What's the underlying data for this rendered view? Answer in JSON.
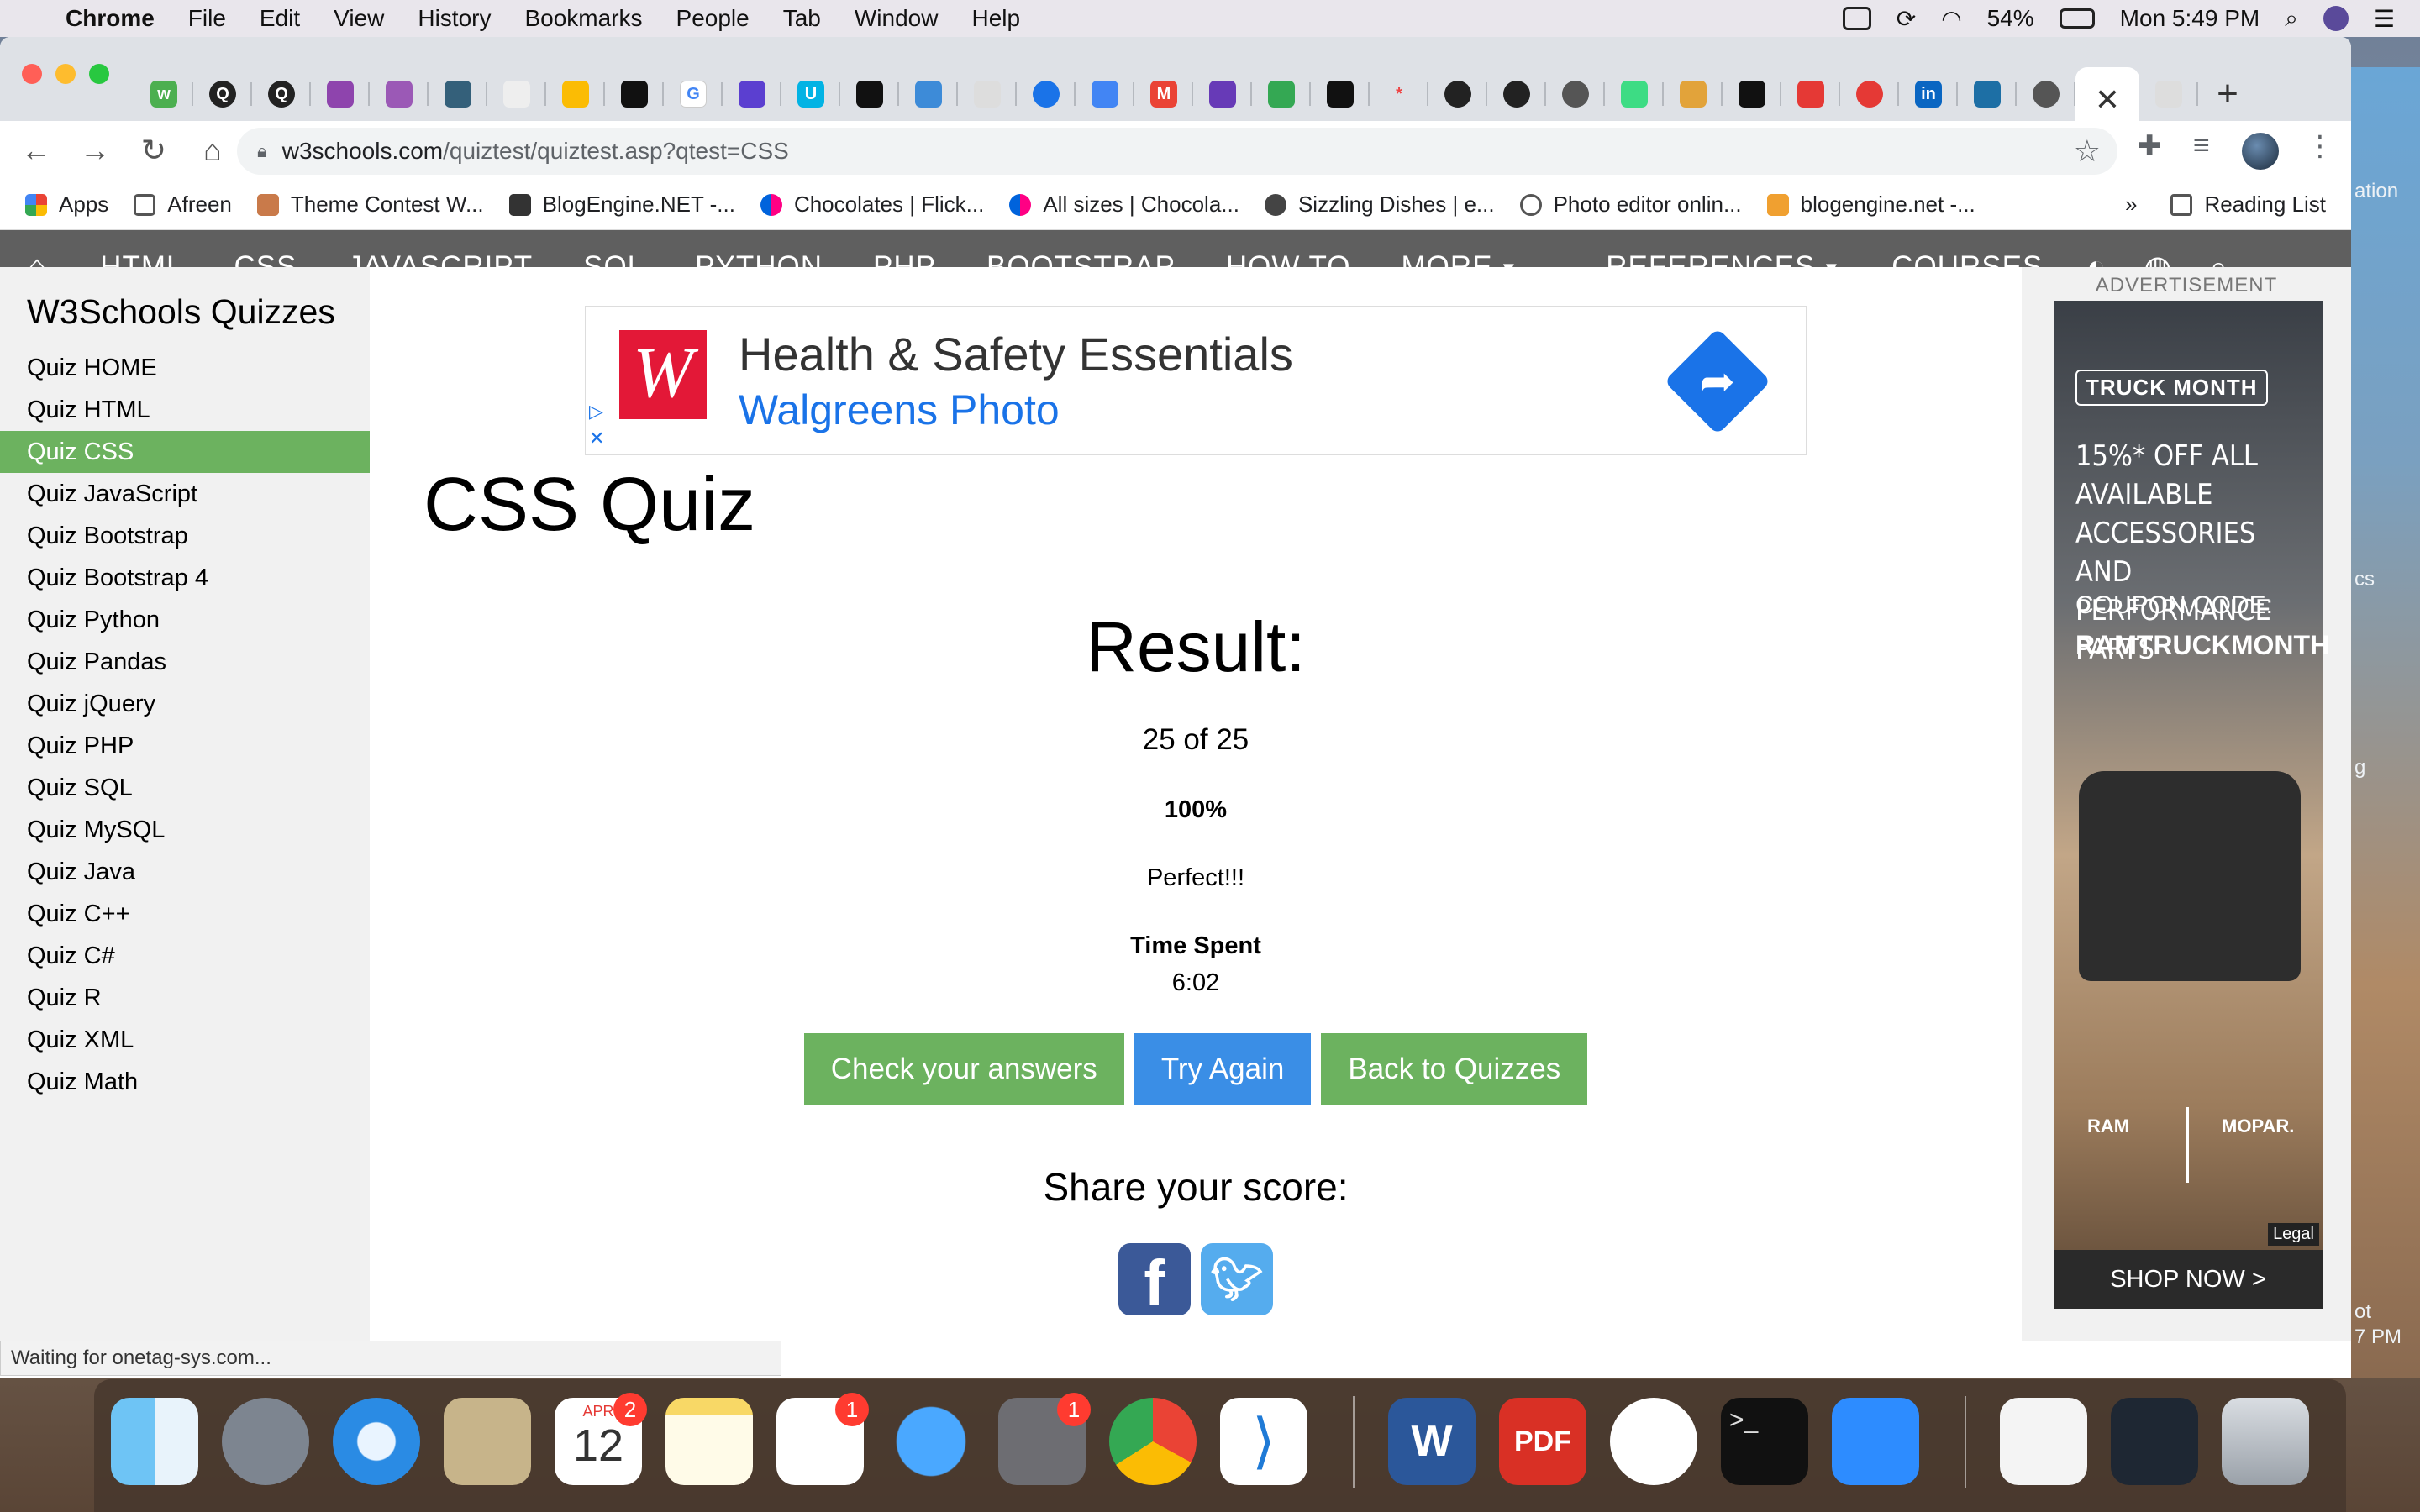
{
  "menubar": {
    "app": "Chrome",
    "items": [
      "File",
      "Edit",
      "View",
      "History",
      "Bookmarks",
      "People",
      "Tab",
      "Window",
      "Help"
    ],
    "battery": "54%",
    "clock": "Mon 5:49 PM"
  },
  "tabs": {
    "active_close": "✕",
    "new_tab": "+"
  },
  "address": {
    "domain": "w3schools.com",
    "path": "/quiztest/quiztest.asp?qtest=CSS"
  },
  "bookmarks": {
    "items": [
      "Apps",
      "Afreen",
      "Theme Contest W...",
      "BlogEngine.NET -...",
      "Chocolates | Flick...",
      "All sizes | Chocola...",
      "Sizzling Dishes | e...",
      "Photo editor onlin...",
      "blogengine.net -..."
    ],
    "overflow": "»",
    "reading_list": "Reading List"
  },
  "nav": {
    "items": [
      "HTML",
      "CSS",
      "JAVASCRIPT",
      "SQL",
      "PYTHON",
      "PHP",
      "BOOTSTRAP",
      "HOW TO"
    ],
    "more": "MORE",
    "references": "REFERENCES",
    "courses": "COURSES"
  },
  "sidebar": {
    "title": "W3Schools Quizzes",
    "items": [
      "Quiz HOME",
      "Quiz HTML",
      "Quiz CSS",
      "Quiz JavaScript",
      "Quiz Bootstrap",
      "Quiz Bootstrap 4",
      "Quiz Python",
      "Quiz Pandas",
      "Quiz jQuery",
      "Quiz PHP",
      "Quiz SQL",
      "Quiz MySQL",
      "Quiz Java",
      "Quiz C++",
      "Quiz C#",
      "Quiz R",
      "Quiz XML",
      "Quiz Math"
    ],
    "active_index": 2
  },
  "top_ad": {
    "headline": "Health & Safety Essentials",
    "sub": "Walgreens Photo"
  },
  "quiz": {
    "title": "CSS Quiz",
    "result_heading": "Result:",
    "score": "25 of 25",
    "percent": "100%",
    "verdict": "Perfect!!!",
    "time_label": "Time Spent",
    "time_value": "6:02",
    "buttons": {
      "check": "Check your answers",
      "try_again": "Try Again",
      "back": "Back to Quizzes"
    },
    "share_heading": "Share your score:"
  },
  "side_ad": {
    "label": "ADVERTISEMENT",
    "tag": "TRUCK MONTH",
    "offer": "15%* OFF ALL AVAILABLE ACCESSORIES AND PERFORMANCE PARTS",
    "coupon_label": "COUPON CODE:",
    "coupon_code": "RAMTRUCKMONTH",
    "brand_left": "RAM",
    "brand_right": "MOPAR.",
    "legal": "Legal",
    "cta": "SHOP NOW >"
  },
  "status": "Waiting for onetag-sys.com...",
  "dock": {
    "calendar_month": "APR",
    "calendar_day": "12",
    "badges": {
      "calendar": "2",
      "reminders": "1",
      "prefs": "1"
    }
  },
  "desktop_fragments": [
    "ation",
    "cs",
    "g",
    "ot",
    "7 PM"
  ]
}
